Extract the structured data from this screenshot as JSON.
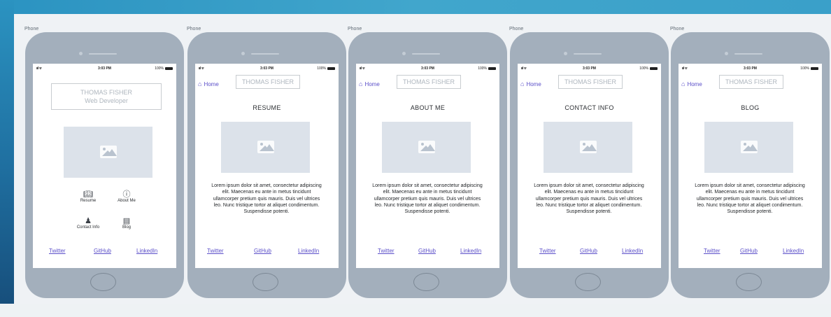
{
  "phones": [
    {
      "label": "Phone",
      "status": {
        "signal": "ııl ᯤ",
        "time": "3:03 PM",
        "battery": "100%"
      },
      "name_line1": "THOMAS FISHER",
      "name_line2": "Web Developer",
      "nav": [
        {
          "label": "Resume",
          "icon": "book-icon"
        },
        {
          "label": "About Me",
          "icon": "info-icon"
        },
        {
          "label": "Contact Info",
          "icon": "person-add-icon"
        },
        {
          "label": "Blog",
          "icon": "document-icon"
        }
      ],
      "footer": [
        "Twitter",
        "GitHub",
        "LinkedIn"
      ]
    },
    {
      "label": "Phone",
      "status": {
        "signal": "ııl ᯤ",
        "time": "3:03 PM",
        "battery": "100%"
      },
      "home": "Home",
      "name": "THOMAS FISHER",
      "title": "RESUME",
      "lorem": "Lorem ipsum dolor sit amet, consectetur adipiscing elit. Maecenas eu ante in metus tincidunt ullamcorper pretium quis mauris. Duis vel ultrices leo. Nunc tristique tortor at aliquet condimentum. Suspendisse potenti.",
      "footer": [
        "Twitter",
        "GitHub",
        "LinkedIn"
      ]
    },
    {
      "label": "Phone",
      "status": {
        "signal": "ııl ᯤ",
        "time": "3:03 PM",
        "battery": "100%"
      },
      "home": "Home",
      "name": "THOMAS FISHER",
      "title": "ABOUT ME",
      "lorem": "Lorem ipsum dolor sit amet, consectetur adipiscing elit. Maecenas eu ante in metus tincidunt ullamcorper pretium quis mauris. Duis vel ultrices leo. Nunc tristique tortor at aliquet condimentum. Suspendisse potenti.",
      "footer": [
        "Twitter",
        "GitHub",
        "LinkedIn"
      ]
    },
    {
      "label": "Phone",
      "status": {
        "signal": "ııl ᯤ",
        "time": "3:03 PM",
        "battery": "100%"
      },
      "home": "Home",
      "name": "THOMAS FISHER",
      "title": "CONTACT INFO",
      "lorem": "Lorem ipsum dolor sit amet, consectetur adipiscing elit. Maecenas eu ante in metus tincidunt ullamcorper pretium quis mauris. Duis vel ultrices leo. Nunc tristique tortor at aliquet condimentum. Suspendisse potenti.",
      "footer": [
        "Twitter",
        "GitHub",
        "LinkedIn"
      ]
    },
    {
      "label": "Phone",
      "status": {
        "signal": "ııl ᯤ",
        "time": "3:03 PM",
        "battery": "100%"
      },
      "home": "Home",
      "name": "THOMAS FISHER",
      "title": "BLOG",
      "lorem": "Lorem ipsum dolor sit amet, consectetur adipiscing elit. Maecenas eu ante in metus tincidunt ullamcorper pretium quis mauris. Duis vel ultrices leo. Nunc tristique tortor at aliquet condimentum. Suspendisse potenti.",
      "footer": [
        "Twitter",
        "GitHub",
        "LinkedIn"
      ]
    }
  ],
  "colors": {
    "accent": "#5b4fc9",
    "phone_body": "#a3afbc",
    "placeholder": "#dce2ea"
  }
}
